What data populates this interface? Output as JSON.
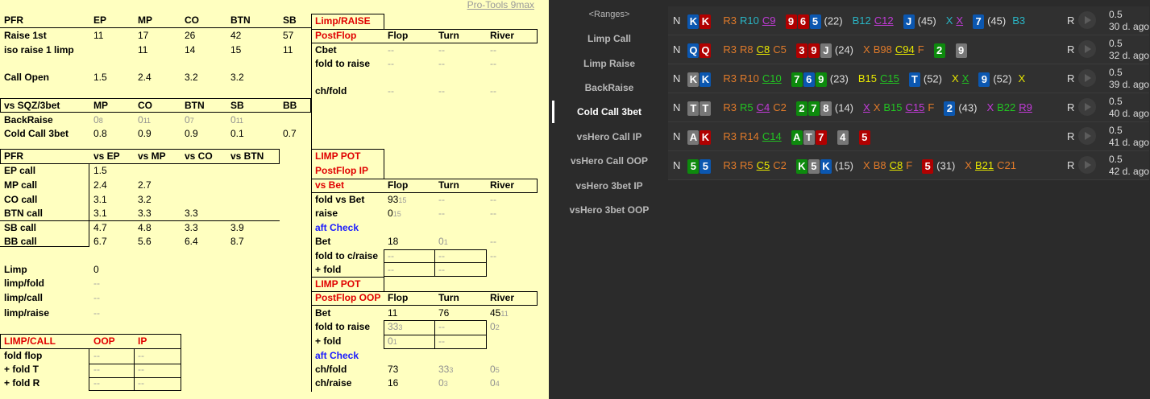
{
  "brand": "Pro-Tools 9max",
  "pfr": {
    "title": "PFR",
    "cols": [
      "EP",
      "MP",
      "CO",
      "BTN",
      "SB"
    ],
    "rows": [
      {
        "label": "Raise 1st",
        "vals": [
          "11",
          "17",
          "26",
          "42",
          "57"
        ]
      },
      {
        "label": "iso raise 1 limp",
        "vals": [
          "",
          "11",
          "14",
          "15",
          "11"
        ]
      },
      {
        "label": "Call Open",
        "vals": [
          "1.5",
          "2.4",
          "3.2",
          "3.2",
          ""
        ]
      }
    ]
  },
  "sqz": {
    "title": "vs SQZ/3bet",
    "cols": [
      "MP",
      "CO",
      "BTN",
      "SB",
      "BB"
    ],
    "rows": [
      {
        "label": "BackRaise",
        "vals": [
          {
            "v": "0",
            "s": "8"
          },
          {
            "v": "0",
            "s": "11"
          },
          {
            "v": "0",
            "s": "7"
          },
          {
            "v": "0",
            "s": "11"
          },
          ""
        ]
      },
      {
        "label": "Cold Call 3bet",
        "vals": [
          "0.8",
          "0.9",
          "0.9",
          "0.1",
          "0.7"
        ]
      }
    ]
  },
  "pfr2": {
    "title": "PFR",
    "cols": [
      "vs EP",
      "vs MP",
      "vs CO",
      "vs BTN"
    ],
    "rows": [
      {
        "label": "EP call",
        "vals": [
          "1.5",
          "",
          "",
          ""
        ]
      },
      {
        "label": "MP call",
        "vals": [
          "2.4",
          "2.7",
          "",
          ""
        ]
      },
      {
        "label": "CO call",
        "vals": [
          "3.1",
          "3.2",
          "",
          ""
        ]
      },
      {
        "label": "BTN call",
        "vals": [
          "3.1",
          "3.3",
          "3.3",
          ""
        ]
      },
      {
        "label": "SB call",
        "vals": [
          "4.7",
          "4.8",
          "3.3",
          "3.9"
        ]
      },
      {
        "label": "BB call",
        "vals": [
          "6.7",
          "5.6",
          "6.4",
          "8.7"
        ]
      }
    ]
  },
  "limp": {
    "rows": [
      {
        "label": "Limp",
        "val": "0"
      },
      {
        "label": "limp/fold",
        "val": "--"
      },
      {
        "label": "limp/call",
        "val": "--"
      },
      {
        "label": "limp/raise",
        "val": "--"
      }
    ]
  },
  "limpcall": {
    "title": "LIMP/CALL",
    "cols": [
      "OOP",
      "IP"
    ],
    "rows": [
      {
        "label": "fold flop",
        "vals": [
          "--",
          "--"
        ]
      },
      {
        "label": "+ fold T",
        "vals": [
          "--",
          "--"
        ]
      },
      {
        "label": "+ fold R",
        "vals": [
          "--",
          "--"
        ]
      }
    ]
  },
  "limpraise": {
    "title": "Limp/RAISE",
    "sub": "PostFlop",
    "cols": [
      "Flop",
      "Turn",
      "River"
    ],
    "rows": [
      {
        "label": "Cbet",
        "vals": [
          "--",
          "--",
          "--"
        ]
      },
      {
        "label": "fold to raise",
        "vals": [
          "--",
          "--",
          "--"
        ]
      },
      {
        "label": "ch/fold",
        "vals": [
          "--",
          "--",
          "--"
        ]
      }
    ]
  },
  "limppotip": {
    "title": "LIMP POT",
    "sub": "PostFlop IP",
    "sub2": "vs Bet",
    "cols": [
      "Flop",
      "Turn",
      "River"
    ],
    "rows": [
      {
        "label": "fold vs Bet",
        "vals": [
          {
            "v": "93",
            "s": "15"
          },
          "--",
          "--"
        ]
      },
      {
        "label": "raise",
        "vals": [
          {
            "v": "0",
            "s": "15"
          },
          "--",
          "--"
        ]
      }
    ],
    "sect": "aft Check",
    "rows2": [
      {
        "label": "Bet",
        "vals": [
          "18",
          {
            "v": "0",
            "s": "1",
            "gray": true
          },
          "--"
        ]
      },
      {
        "label": "fold to c/raise",
        "vals": [
          "--",
          "--",
          "--"
        ]
      },
      {
        "label": "+ fold",
        "vals": [
          "--",
          "--",
          ""
        ]
      }
    ]
  },
  "limppotoop": {
    "title": "LIMP POT",
    "sub": "PostFlop OOP",
    "cols": [
      "Flop",
      "Turn",
      "River"
    ],
    "rows": [
      {
        "label": "Bet",
        "vals": [
          "11",
          "76",
          {
            "v": "45",
            "s": "11"
          }
        ]
      },
      {
        "label": "fold to raise",
        "vals": [
          {
            "v": "33",
            "s": "3",
            "gray": true
          },
          "--",
          {
            "v": "0",
            "s": "2",
            "gray": true
          }
        ]
      },
      {
        "label": "+ fold",
        "vals": [
          {
            "v": "0",
            "s": "1",
            "gray": true
          },
          "--",
          ""
        ]
      }
    ],
    "sect": "aft Check",
    "rows2": [
      {
        "label": "ch/fold",
        "vals": [
          "73",
          {
            "v": "33",
            "s": "3",
            "gray": true
          },
          {
            "v": "0",
            "s": "5",
            "gray": true
          }
        ]
      },
      {
        "label": "ch/raise",
        "vals": [
          "16",
          {
            "v": "0",
            "s": "3",
            "gray": true
          },
          {
            "v": "0",
            "s": "4",
            "gray": true
          }
        ]
      }
    ]
  },
  "nav": [
    "<Ranges>",
    "Limp Call",
    "Limp Raise",
    "BackRaise",
    "Cold Call 3bet",
    "vsHero Call IP",
    "vsHero Call OOP",
    "vsHero 3bet IP",
    "vsHero 3bet OOP"
  ],
  "nav_selected": 4,
  "colors": {
    "blue_card": "#0b57b0",
    "red_card": "#b00000",
    "green_card": "#0d8a0d",
    "gray_card": "#777777",
    "R": "#e07a2a",
    "C": "#9a2bd0",
    "B": "#c8c800",
    "X": "#7a3bd8",
    "F": "#e07a2a"
  },
  "hands": [
    {
      "n": "N",
      "cards": [
        [
          "K",
          "b"
        ],
        [
          "K",
          "r"
        ]
      ],
      "pre": [
        [
          "R3",
          "#e07a2a",
          0
        ],
        [
          "R10",
          "#29b6c6",
          0
        ],
        [
          "C9",
          "#c23bd8",
          1
        ]
      ],
      "flop": [
        [
          "9",
          "r"
        ],
        [
          "6",
          "r"
        ],
        [
          "5",
          "b"
        ]
      ],
      "fcnt": "(22)",
      "fa": [
        [
          "B12",
          "#29b6c6",
          0
        ],
        [
          "C12",
          "#c23bd8",
          1
        ]
      ],
      "turn": [
        [
          "J",
          "b"
        ]
      ],
      "tcnt": "(45)",
      "ta": [
        [
          "X",
          "#29b6c6",
          0
        ],
        [
          "X",
          "#c23bd8",
          1
        ]
      ],
      "river": [
        [
          "7",
          "b"
        ]
      ],
      "rcnt": "(45)",
      "ra": [
        [
          "B3",
          "#29b6c6",
          0
        ]
      ],
      "r": "R",
      "bb": "0.5",
      "ago": "30 d. ago"
    },
    {
      "n": "N",
      "cards": [
        [
          "Q",
          "b"
        ],
        [
          "Q",
          "r"
        ]
      ],
      "pre": [
        [
          "R3",
          "#e07a2a",
          0
        ],
        [
          "R8",
          "#e07a2a",
          0
        ],
        [
          "C8",
          "#e8e800",
          1
        ],
        [
          "C5",
          "#e07a2a",
          0
        ]
      ],
      "flop": [
        [
          "3",
          "r"
        ],
        [
          "9",
          "r"
        ],
        [
          "J",
          "x"
        ]
      ],
      "fcnt": "(24)",
      "fa": [
        [
          "X",
          "#e07a2a",
          0
        ],
        [
          "B98",
          "#e07a2a",
          0
        ],
        [
          "C94",
          "#e8e800",
          1
        ],
        [
          "F",
          "#e07a2a",
          0
        ]
      ],
      "turn": [
        [
          "2",
          "g"
        ]
      ],
      "tcnt": "",
      "ta": [],
      "river": [
        [
          "9",
          "x"
        ]
      ],
      "rcnt": "",
      "ra": [],
      "r": "R",
      "bb": "0.5",
      "ago": "32 d. ago"
    },
    {
      "n": "N",
      "cards": [
        [
          "K",
          "x"
        ],
        [
          "K",
          "b"
        ]
      ],
      "pre": [
        [
          "R3",
          "#e07a2a",
          0
        ],
        [
          "R10",
          "#e07a2a",
          0
        ],
        [
          "C10",
          "#22c422",
          1
        ]
      ],
      "flop": [
        [
          "7",
          "g"
        ],
        [
          "6",
          "b"
        ],
        [
          "9",
          "g"
        ]
      ],
      "fcnt": "(23)",
      "fa": [
        [
          "B15",
          "#e8e800",
          0
        ],
        [
          "C15",
          "#22c422",
          1
        ]
      ],
      "turn": [
        [
          "T",
          "b"
        ]
      ],
      "tcnt": "(52)",
      "ta": [
        [
          "X",
          "#e8e800",
          0
        ],
        [
          "X",
          "#22c422",
          1
        ]
      ],
      "river": [
        [
          "9",
          "b"
        ]
      ],
      "rcnt": "(52)",
      "ra": [
        [
          "X",
          "#e8e800",
          0
        ]
      ],
      "r": "R",
      "bb": "0.5",
      "ago": "39 d. ago"
    },
    {
      "n": "N",
      "cards": [
        [
          "T",
          "x"
        ],
        [
          "T",
          "x"
        ]
      ],
      "pre": [
        [
          "R3",
          "#e07a2a",
          0
        ],
        [
          "R5",
          "#22c422",
          0
        ],
        [
          "C4",
          "#c23bd8",
          1
        ],
        [
          "C2",
          "#e07a2a",
          0
        ]
      ],
      "flop": [
        [
          "2",
          "g"
        ],
        [
          "7",
          "g"
        ],
        [
          "8",
          "x"
        ]
      ],
      "fcnt": "(14)",
      "fa": [
        [
          "X",
          "#c23bd8",
          1
        ],
        [
          "X",
          "#e07a2a",
          0
        ],
        [
          "B15",
          "#22c422",
          0
        ],
        [
          "C15",
          "#c23bd8",
          1
        ],
        [
          "F",
          "#e07a2a",
          0
        ]
      ],
      "turn": [
        [
          "2",
          "b"
        ]
      ],
      "tcnt": "(43)",
      "ta": [
        [
          "X",
          "#c23bd8",
          0
        ],
        [
          "B22",
          "#22c422",
          0
        ],
        [
          "R9",
          "#c23bd8",
          1
        ]
      ],
      "river": [],
      "rcnt": "",
      "ra": [],
      "r": "R",
      "bb": "0.5",
      "ago": "40 d. ago"
    },
    {
      "n": "N",
      "cards": [
        [
          "A",
          "x"
        ],
        [
          "K",
          "r"
        ]
      ],
      "pre": [
        [
          "R3",
          "#e07a2a",
          0
        ],
        [
          "R14",
          "#e07a2a",
          0
        ],
        [
          "C14",
          "#22c422",
          1
        ]
      ],
      "flop": [
        [
          "A",
          "g"
        ],
        [
          "T",
          "x"
        ],
        [
          "7",
          "r"
        ]
      ],
      "fcnt": "",
      "fa": [],
      "turn": [
        [
          "4",
          "x"
        ]
      ],
      "tcnt": "",
      "ta": [],
      "river": [
        [
          "5",
          "r"
        ]
      ],
      "rcnt": "",
      "ra": [],
      "r": "R",
      "bb": "0.5",
      "ago": "41 d. ago"
    },
    {
      "n": "N",
      "cards": [
        [
          "5",
          "g"
        ],
        [
          "5",
          "b"
        ]
      ],
      "pre": [
        [
          "R3",
          "#e07a2a",
          0
        ],
        [
          "R5",
          "#e07a2a",
          0
        ],
        [
          "C5",
          "#e8e800",
          1
        ],
        [
          "C2",
          "#e07a2a",
          0
        ]
      ],
      "flop": [
        [
          "K",
          "g"
        ],
        [
          "5",
          "x"
        ],
        [
          "K",
          "b"
        ]
      ],
      "fcnt": "(15)",
      "fa": [
        [
          "X",
          "#e07a2a",
          0
        ],
        [
          "B8",
          "#e07a2a",
          0
        ],
        [
          "C8",
          "#e8e800",
          1
        ],
        [
          "F",
          "#e07a2a",
          0
        ]
      ],
      "turn": [
        [
          "5",
          "r"
        ]
      ],
      "tcnt": "(31)",
      "ta": [
        [
          "X",
          "#e07a2a",
          0
        ],
        [
          "B21",
          "#e8e800",
          1
        ],
        [
          "C21",
          "#e07a2a",
          0
        ]
      ],
      "river": [],
      "rcnt": "",
      "ra": [],
      "r": "R",
      "bb": "0.5",
      "ago": "42 d. ago"
    }
  ]
}
